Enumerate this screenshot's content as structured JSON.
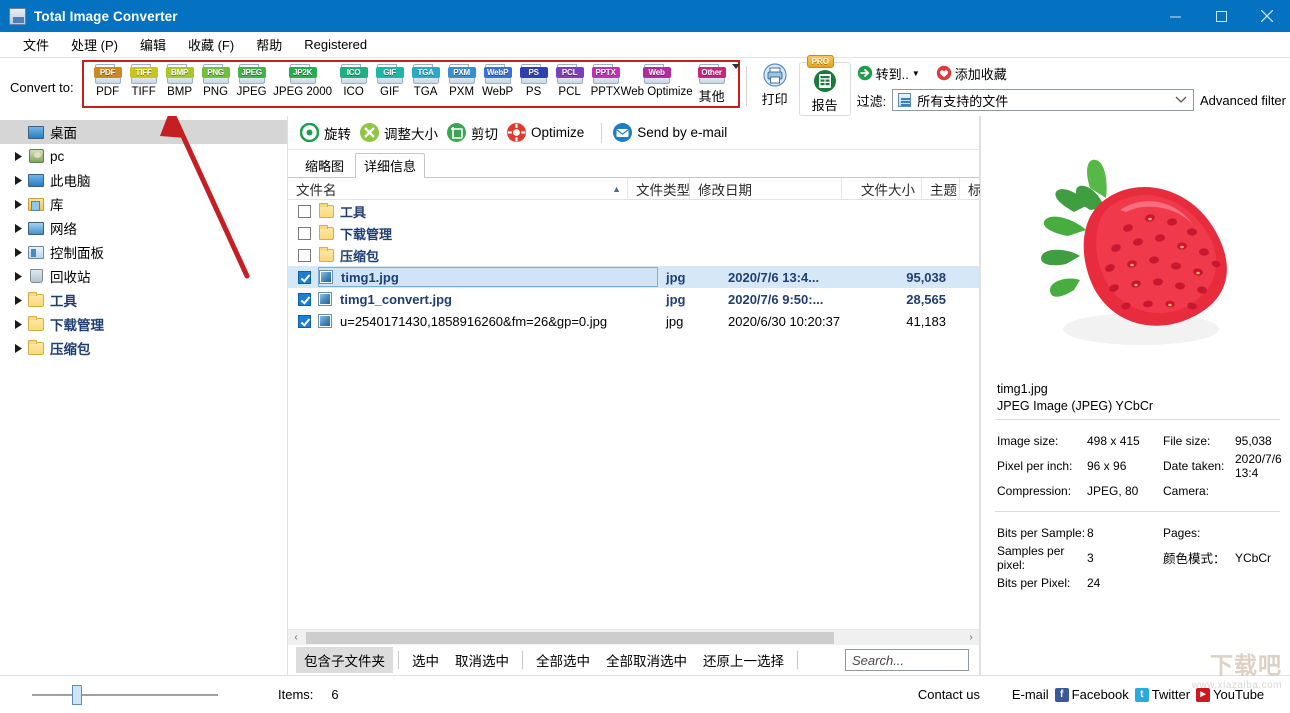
{
  "window": {
    "title": "Total Image Converter",
    "minimize": "–",
    "maximize": "□",
    "close": "✕"
  },
  "menubar": {
    "items": [
      {
        "label": "文件"
      },
      {
        "label": "处理 (P)"
      },
      {
        "label": "编辑"
      },
      {
        "label": "收藏 (F)"
      },
      {
        "label": "帮助"
      },
      {
        "label": "Registered"
      }
    ]
  },
  "convert_bar": {
    "label": "Convert to:",
    "formats": [
      {
        "tag": "PDF",
        "label": "PDF",
        "color": "#c98a1e"
      },
      {
        "tag": "TIFF",
        "label": "TIFF",
        "color": "#c8c420"
      },
      {
        "tag": "BMP",
        "label": "BMP",
        "color": "#a8c72a"
      },
      {
        "tag": "PNG",
        "label": "PNG",
        "color": "#72bf3c"
      },
      {
        "tag": "JPEG",
        "label": "JPEG",
        "color": "#41b14a"
      },
      {
        "tag": "JP2K",
        "label": "JPEG 2000",
        "color": "#27ac52",
        "wide": true
      },
      {
        "tag": "ICO",
        "label": "ICO",
        "color": "#1db082"
      },
      {
        "tag": "GIF",
        "label": "GIF",
        "color": "#21b5a6"
      },
      {
        "tag": "TGA",
        "label": "TGA",
        "color": "#2aa9c8"
      },
      {
        "tag": "PXM",
        "label": "PXM",
        "color": "#3a8ed0"
      },
      {
        "tag": "WebP",
        "label": "WebP",
        "color": "#3b6fd1"
      },
      {
        "tag": "PS",
        "label": "PS",
        "color": "#2f3fb0"
      },
      {
        "tag": "PCL",
        "label": "PCL",
        "color": "#7b3fb8"
      },
      {
        "tag": "PPTX",
        "label": "PPTX",
        "color": "#c033b0"
      },
      {
        "tag": "Web",
        "label": "Web Optimize",
        "color": "#b72a9c",
        "wide": true
      },
      {
        "tag": "Other",
        "label": "其他",
        "color": "#c02a7e",
        "other": true
      }
    ],
    "print_label": "打印",
    "report_label": "报告",
    "pro_badge": "PRO",
    "goto_label": "转到..",
    "favorite_label": "添加收藏",
    "filter_label": "过滤:",
    "filter_value": "所有支持的文件",
    "advanced_filter": "Advanced filter"
  },
  "tree": {
    "root": {
      "label": "桌面",
      "icon": "monitor-icon"
    },
    "items": [
      {
        "label": "pc",
        "icon": "user-icon",
        "blue": false
      },
      {
        "label": "此电脑",
        "icon": "monitor-icon",
        "blue": false
      },
      {
        "label": "库",
        "icon": "library-icon",
        "blue": false
      },
      {
        "label": "网络",
        "icon": "network-icon",
        "blue": false
      },
      {
        "label": "控制面板",
        "icon": "control-panel-icon",
        "blue": false
      },
      {
        "label": "回收站",
        "icon": "recycle-bin-icon",
        "blue": false
      },
      {
        "label": "工具",
        "icon": "folder-icon",
        "blue": true
      },
      {
        "label": "下载管理",
        "icon": "folder-icon",
        "blue": true
      },
      {
        "label": "压缩包",
        "icon": "folder-icon",
        "blue": true
      }
    ]
  },
  "actions": [
    {
      "label": "旋转",
      "icon": "rotate-icon",
      "color": "#1f9e4c"
    },
    {
      "label": "调整大小",
      "icon": "resize-icon",
      "color": "#8dc63f"
    },
    {
      "label": "剪切",
      "icon": "crop-icon",
      "color": "#3aa655"
    },
    {
      "label": "Optimize",
      "icon": "optimize-icon",
      "color": "#e03a2f"
    },
    {
      "label": "Send by e-mail",
      "icon": "email-icon",
      "color": "#1f7ec0"
    }
  ],
  "tabs": [
    {
      "label": "缩略图",
      "active": false
    },
    {
      "label": "详细信息",
      "active": true
    }
  ],
  "file_list": {
    "columns": [
      "文件名",
      "文件类型",
      "修改日期",
      "文件大小",
      "主题",
      "标题"
    ],
    "sort_indicator": "▲",
    "rows": [
      {
        "checked": false,
        "icon": "folder-icon",
        "name": "工具",
        "type": "",
        "date": "",
        "size": "",
        "blue": true,
        "selected": false
      },
      {
        "checked": false,
        "icon": "folder-icon",
        "name": "下载管理",
        "type": "",
        "date": "",
        "size": "",
        "blue": true,
        "selected": false
      },
      {
        "checked": false,
        "icon": "folder-icon",
        "name": "压缩包",
        "type": "",
        "date": "",
        "size": "",
        "blue": true,
        "selected": false
      },
      {
        "checked": true,
        "icon": "image-icon",
        "name": "timg1.jpg",
        "type": "jpg",
        "date": "2020/7/6 13:4...",
        "size": "95,038",
        "blue": true,
        "selected": true
      },
      {
        "checked": true,
        "icon": "image-icon",
        "name": "timg1_convert.jpg",
        "type": "jpg",
        "date": "2020/7/6 9:50:...",
        "size": "28,565",
        "blue": true,
        "selected": false
      },
      {
        "checked": true,
        "icon": "image-icon",
        "name": "u=2540171430,1858916260&fm=26&gp=0.jpg",
        "type": "jpg",
        "date": "2020/6/30 10:20:37",
        "size": "41,183",
        "blue": false,
        "selected": false
      }
    ]
  },
  "selection_bar": {
    "buttons": [
      {
        "label": "包含子文件夹",
        "active": true
      },
      {
        "label": "选中",
        "active": false
      },
      {
        "label": "取消选中",
        "active": false
      },
      {
        "label": "全部选中",
        "active": false
      },
      {
        "label": "全部取消选中",
        "active": false
      },
      {
        "label": "还原上一选择",
        "active": false
      }
    ],
    "search_placeholder": "Search..."
  },
  "info_panel": {
    "file_name": "timg1.jpg",
    "file_type": "JPEG Image (JPEG) YCbCr",
    "rows_top": [
      {
        "k1": "Image size:",
        "v1": "498 x 415",
        "k2": "File size:",
        "v2": "95,038"
      },
      {
        "k1": "Pixel per inch:",
        "v1": "96 x 96",
        "k2": "Date taken:",
        "v2": "2020/7/6 13:4"
      },
      {
        "k1": "Compression:",
        "v1": "JPEG, 80",
        "k2": "Camera:",
        "v2": ""
      }
    ],
    "rows_bottom": [
      {
        "k1": "Bits per Sample:",
        "v1": "8",
        "k2": "Pages:",
        "v2": "",
        "k2cn": false
      },
      {
        "k1": "Samples per pixel:",
        "v1": "3",
        "k2": "颜色模式：",
        "v2": "YCbCr",
        "k2cn": true
      },
      {
        "k1": "Bits per Pixel:",
        "v1": "24",
        "k2": "",
        "v2": "",
        "k2cn": false
      }
    ]
  },
  "footer": {
    "items_label": "Items:",
    "items_count": "6",
    "contact": "Contact us",
    "social": [
      {
        "label": "E-mail",
        "icon": "email-icon",
        "color": ""
      },
      {
        "label": "Facebook",
        "icon": "facebook-icon",
        "color": "#3b5998"
      },
      {
        "label": "Twitter",
        "icon": "twitter-icon",
        "color": "#29a9e0"
      },
      {
        "label": "YouTube",
        "icon": "youtube-icon",
        "color": "#cc181e"
      }
    ]
  },
  "watermark": {
    "main": "下载吧",
    "sub": "www.xiazaiba.com"
  }
}
